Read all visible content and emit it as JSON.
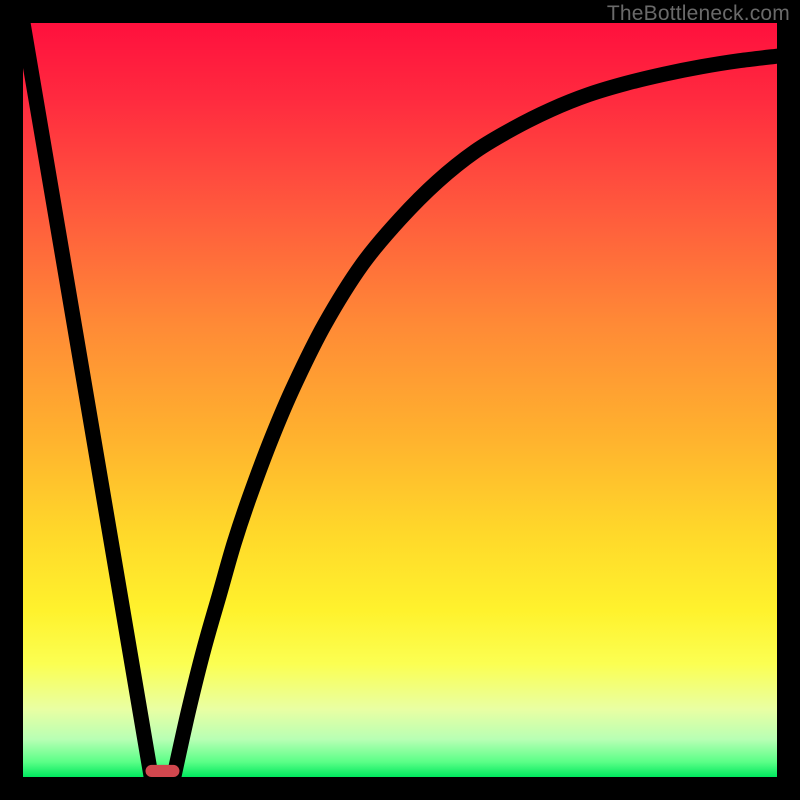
{
  "watermark": "TheBottleneck.com",
  "colors": {
    "frame": "#000000",
    "gradient_top": "#ff103d",
    "gradient_bottom": "#00e85e",
    "curve": "#000000",
    "marker": "#d1474e"
  },
  "chart_data": {
    "type": "line",
    "title": "",
    "xlabel": "",
    "ylabel": "",
    "xlim": [
      0,
      100
    ],
    "ylim": [
      0,
      100
    ],
    "grid": false,
    "legend": false,
    "annotations": [],
    "series": [
      {
        "name": "left-line",
        "x": [
          0,
          17
        ],
        "y": [
          100,
          0
        ]
      },
      {
        "name": "right-curve",
        "x": [
          20,
          22,
          24,
          26,
          28,
          30,
          33,
          36,
          40,
          45,
          50,
          55,
          60,
          65,
          70,
          75,
          80,
          85,
          90,
          95,
          100
        ],
        "y": [
          0,
          9,
          17,
          24,
          31,
          37,
          45,
          52,
          60,
          68,
          74,
          79,
          83,
          86,
          88.5,
          90.5,
          92,
          93.2,
          94.2,
          95,
          95.6
        ]
      }
    ],
    "marker": {
      "x": 18.5,
      "y": 0,
      "width": 4.5,
      "height": 1.6,
      "rx": 0.8
    }
  }
}
